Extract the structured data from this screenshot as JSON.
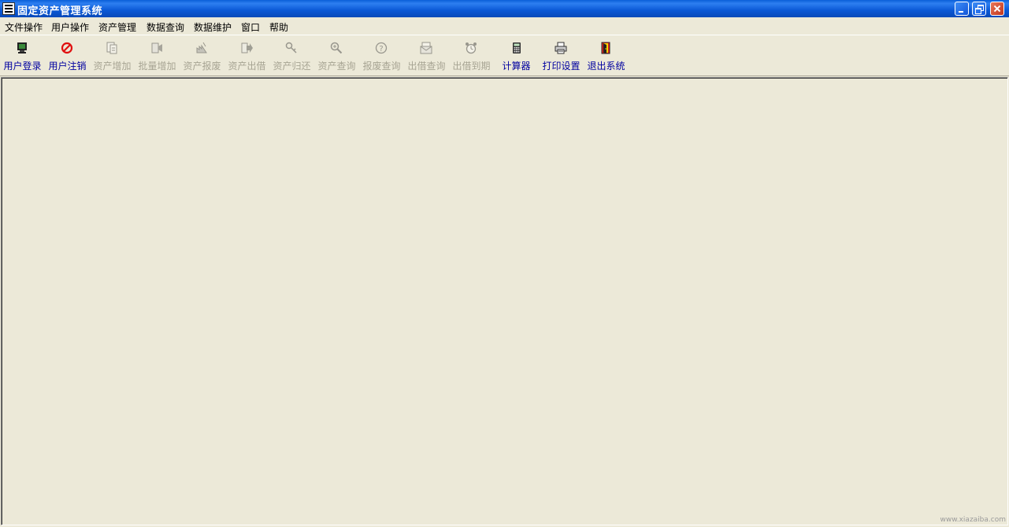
{
  "window": {
    "title": "固定资产管理系统"
  },
  "menu": [
    "文件操作",
    "用户操作",
    "资产管理",
    "数据查询",
    "数据维护",
    "窗口",
    "帮助"
  ],
  "toolbar": [
    {
      "label": "用户登录",
      "icon": "monitor-icon",
      "enabled": true
    },
    {
      "label": "用户注销",
      "icon": "no-entry-icon",
      "enabled": true
    },
    {
      "label": "资产增加",
      "icon": "add-document-icon",
      "enabled": false
    },
    {
      "label": "批量增加",
      "icon": "batch-add-icon",
      "enabled": false
    },
    {
      "label": "资产报废",
      "icon": "scrap-icon",
      "enabled": false
    },
    {
      "label": "资产出借",
      "icon": "lend-arrow-icon",
      "enabled": false
    },
    {
      "label": "资产归还",
      "icon": "return-key-icon",
      "enabled": false
    },
    {
      "label": "资产查询",
      "icon": "magnifier-icon",
      "enabled": false
    },
    {
      "label": "报废查询",
      "icon": "question-icon",
      "enabled": false
    },
    {
      "label": "出借查询",
      "icon": "envelope-icon",
      "enabled": false
    },
    {
      "label": "出借到期",
      "icon": "alarm-clock-icon",
      "enabled": false
    },
    {
      "label": "计算器",
      "icon": "calculator-icon",
      "enabled": true
    },
    {
      "label": "打印设置",
      "icon": "printer-icon",
      "enabled": true
    },
    {
      "label": "退出系统",
      "icon": "exit-door-icon",
      "enabled": true
    }
  ],
  "watermark": "www.xiazaiba.com",
  "colors": {
    "titlebar": "#0a58d6",
    "face": "#ece9d8",
    "enabled_label": "#0000a0",
    "disabled_label": "#a7a493"
  }
}
